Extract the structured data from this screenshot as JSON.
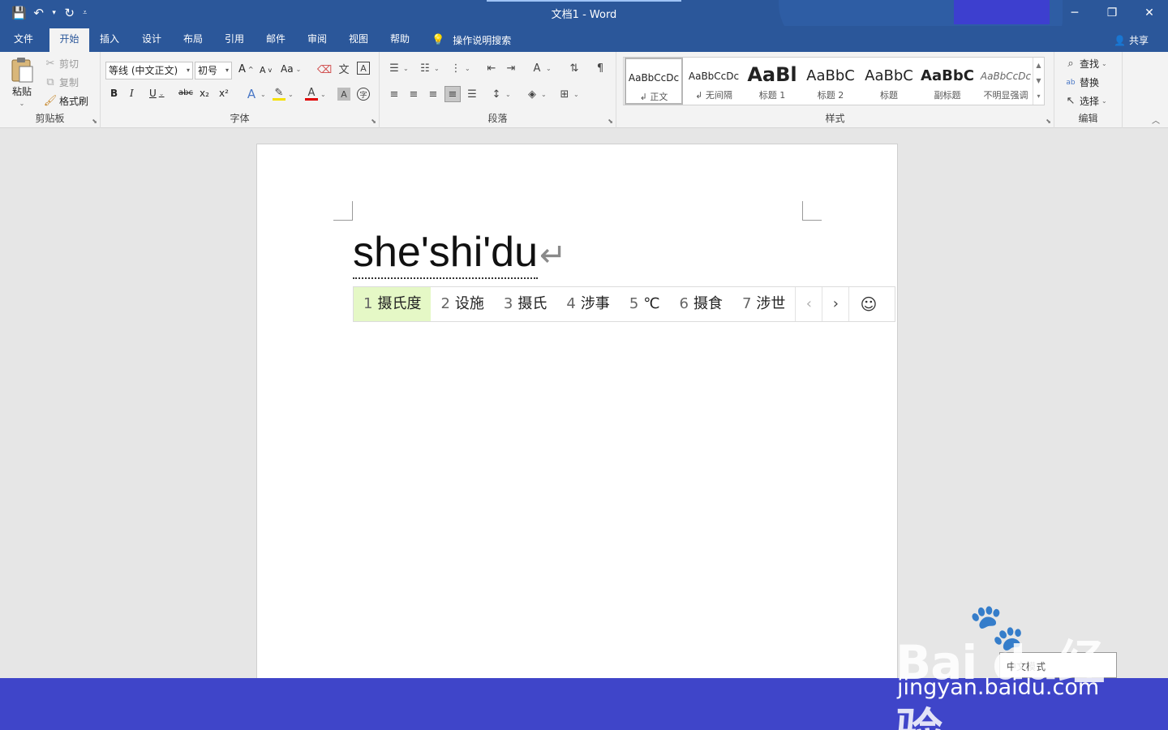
{
  "window": {
    "title": "文档1  -  Word",
    "controls": {
      "minimize": "─",
      "restore": "❐",
      "close": "✕"
    }
  },
  "qat": {
    "save_icon": "💾",
    "undo_icon": "↶",
    "redo_icon": "↻",
    "dropdown": "▾",
    "customize": "⩡"
  },
  "tabs": [
    {
      "label": "文件"
    },
    {
      "label": "开始"
    },
    {
      "label": "插入"
    },
    {
      "label": "设计"
    },
    {
      "label": "布局"
    },
    {
      "label": "引用"
    },
    {
      "label": "邮件"
    },
    {
      "label": "审阅"
    },
    {
      "label": "视图"
    },
    {
      "label": "帮助"
    }
  ],
  "tell_me": {
    "label": "操作说明搜索",
    "icon": "💡"
  },
  "share": {
    "label": "共享",
    "icon": "👤"
  },
  "clipboard": {
    "group_label": "剪贴板",
    "paste": "粘贴",
    "cut": "剪切",
    "copy": "复制",
    "format_painter": "格式刷"
  },
  "font": {
    "group_label": "字体",
    "font_name": "等线 (中文正文)",
    "font_size": "初号",
    "grow": "A",
    "shrink": "A",
    "case": "Aa",
    "bold": "B",
    "italic": "I",
    "underline": "U",
    "strike": "abc",
    "subscript": "x₂",
    "superscript": "x²"
  },
  "paragraph": {
    "group_label": "段落"
  },
  "styles": {
    "group_label": "样式",
    "items": [
      {
        "sample": "AaBbCcDc",
        "name": "↲ 正文"
      },
      {
        "sample": "AaBbCcDc",
        "name": "↲ 无间隔"
      },
      {
        "sample": "AaBl",
        "name": "标题 1"
      },
      {
        "sample": "AaBbC",
        "name": "标题 2"
      },
      {
        "sample": "AaBbC",
        "name": "标题"
      },
      {
        "sample": "AaBbC",
        "name": "副标题"
      },
      {
        "sample": "AaBbCcDc",
        "name": "不明显强调"
      }
    ]
  },
  "editing": {
    "group_label": "编辑",
    "find": "查找",
    "replace": "替换",
    "select": "选择"
  },
  "document": {
    "text": "she'shi'du",
    "paragraph_mark": "↵"
  },
  "ime": {
    "candidates": [
      {
        "num": "1",
        "text": "摄氏度"
      },
      {
        "num": "2",
        "text": "设施"
      },
      {
        "num": "3",
        "text": "摄氏"
      },
      {
        "num": "4",
        "text": "涉事"
      },
      {
        "num": "5",
        "text": "℃"
      },
      {
        "num": "6",
        "text": "摄食"
      },
      {
        "num": "7",
        "text": "涉世"
      }
    ],
    "prev": "‹",
    "next": "›",
    "emoji": "☺",
    "mode_tip": "中文模式"
  },
  "watermark": {
    "logo": "Bai  du经验",
    "url": "jingyan.baidu.com"
  },
  "colors": {
    "word_blue": "#2b579a",
    "ribbon_bg": "#f3f3f3",
    "candidate_highlight": "#e5f8c6",
    "bottom_bar": "#3f45c9"
  }
}
